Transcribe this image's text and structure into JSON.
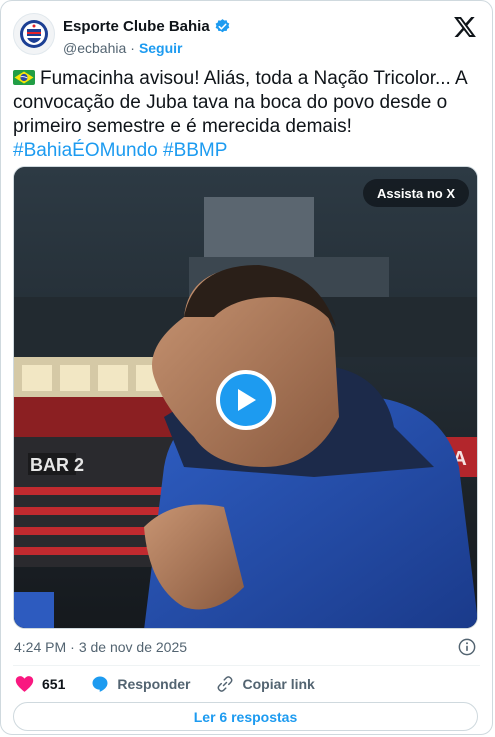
{
  "author": {
    "display_name": "Esporte Clube Bahia",
    "handle": "@ecbahia",
    "separator": "·",
    "follow_label": "Seguir"
  },
  "tweet": {
    "text_main": "Fumacinha avisou! Aliás, toda a Nação Tricolor... A convocação de Juba tava na boca do povo desde o primeiro semestre e é merecida demais!",
    "hashtag_1": "#BahiaÉOMundo",
    "hashtag_2": "#BBMP"
  },
  "media": {
    "watch_label": "Assista no X",
    "scoreboard_text": "BAR 2",
    "ad_text": "ARCA"
  },
  "meta": {
    "time": "4:24 PM",
    "separator": "·",
    "date": "3 de nov de 2025"
  },
  "actions": {
    "likes_count": "651",
    "reply_label": "Responder",
    "copy_label": "Copiar link"
  },
  "replies_button_label": "Ler 6 respostas",
  "colors": {
    "accent": "#1d9bf0",
    "like": "#f91880",
    "text": "#0f1419",
    "muted": "#536471"
  },
  "icons": [
    "bahia-crest-icon",
    "verified-badge-icon",
    "x-logo-icon",
    "brazil-flag-icon",
    "play-icon",
    "info-icon",
    "heart-icon",
    "reply-icon",
    "link-icon"
  ]
}
